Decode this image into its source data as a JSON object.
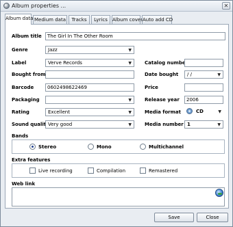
{
  "window": {
    "title": "Album properties ..."
  },
  "tabs": [
    "Album data",
    "Medium data",
    "Tracks",
    "Lyrics",
    "Album cover",
    "Auto add  CD"
  ],
  "form": {
    "album_title_label": "Album title",
    "album_title_value": "The Girl In The Other Room",
    "genre_label": "Genre",
    "genre_value": "Jazz",
    "label_label": "Label",
    "label_value": "Verve Records",
    "catalog_number_label": "Catalog number",
    "catalog_number_value": "",
    "bought_from_label": "Bought from",
    "bought_from_value": "",
    "date_bought_label": "Date bought",
    "date_bought_value": " / /",
    "barcode_label": "Barcode",
    "barcode_value": "0602498622469",
    "price_label": "Price",
    "price_value": "",
    "packaging_label": "Packaging",
    "packaging_value": "",
    "release_year_label": "Release year",
    "release_year_value": "2006",
    "rating_label": "Rating",
    "rating_value": "Excellent",
    "media_format_label": "Media format",
    "media_format_value": "CD",
    "sound_quality_label": "Sound quality",
    "sound_quality_value": "Very good",
    "media_number_label": "Media number",
    "media_number_value": "1"
  },
  "bands": {
    "title": "Bands",
    "options": [
      "Stereo",
      "Mono",
      "Multichannel"
    ],
    "selected": "Stereo"
  },
  "extra_features": {
    "title": "Extra features",
    "options": [
      "Live recording",
      "Compilation",
      "Remastered"
    ]
  },
  "web_link": {
    "label": "Web link",
    "value": ""
  },
  "buttons": {
    "save": "Save",
    "close": "Close"
  }
}
